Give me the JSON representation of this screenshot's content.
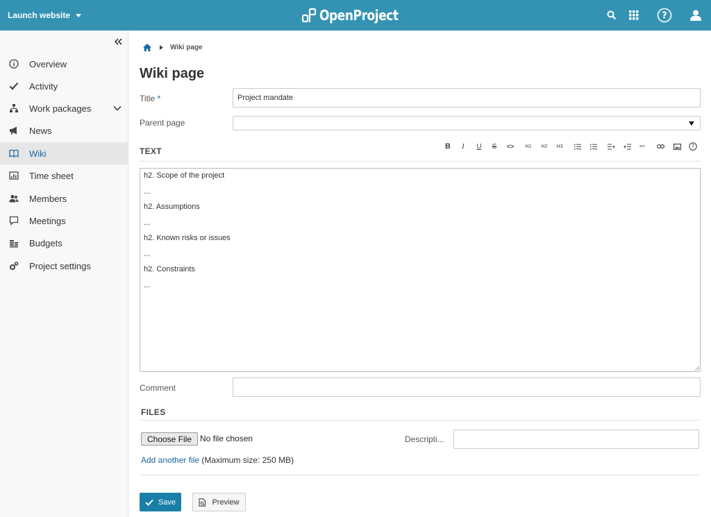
{
  "header": {
    "project_name": "Launch website",
    "logo_text": "OpenProject",
    "icons": [
      "search-icon",
      "modules-grid-icon",
      "help-icon",
      "user-icon"
    ]
  },
  "sidebar": {
    "items": [
      {
        "label": "Overview",
        "icon": "info-icon"
      },
      {
        "label": "Activity",
        "icon": "checkmark-icon"
      },
      {
        "label": "Work packages",
        "icon": "hierarchy-icon"
      },
      {
        "label": "News",
        "icon": "megaphone-icon"
      },
      {
        "label": "Wiki",
        "icon": "book-icon",
        "active": true
      },
      {
        "label": "Time sheet",
        "icon": "chart-icon"
      },
      {
        "label": "Members",
        "icon": "group-icon"
      },
      {
        "label": "Meetings",
        "icon": "speech-bubble-icon"
      },
      {
        "label": "Budgets",
        "icon": "coins-icon"
      },
      {
        "label": "Project settings",
        "icon": "cogs-icon"
      }
    ]
  },
  "breadcrumb": {
    "current": "Wiki page"
  },
  "page": {
    "title": "Wiki page"
  },
  "form": {
    "title_label": "Title",
    "title_required": "*",
    "title_value": "Project mandate",
    "parent_label": "Parent page",
    "parent_value": "",
    "text_section": "TEXT",
    "toolbar_labels": {
      "h1": "H1",
      "h2": "H2",
      "h3": "H3",
      "pre": "pre"
    },
    "editor_lines": [
      "h2. Scope of the project",
      "...",
      "h2. Assumptions",
      "...",
      "h2. Known risks or issues",
      "...",
      "h2. Constraints",
      "..."
    ],
    "comment_label": "Comment",
    "comment_value": ""
  },
  "files": {
    "section": "FILES",
    "choose_button": "Choose File",
    "no_file": "No file chosen",
    "description_label": "Descripti...",
    "description_value": "",
    "add_link": "Add another file",
    "max_size": "(Maximum size: 250 MB)"
  },
  "actions": {
    "save": "Save",
    "preview": "Preview"
  },
  "colors": {
    "header": "#3493b3",
    "accent": "#1a67a3",
    "save_button": "#1a7fa8"
  }
}
